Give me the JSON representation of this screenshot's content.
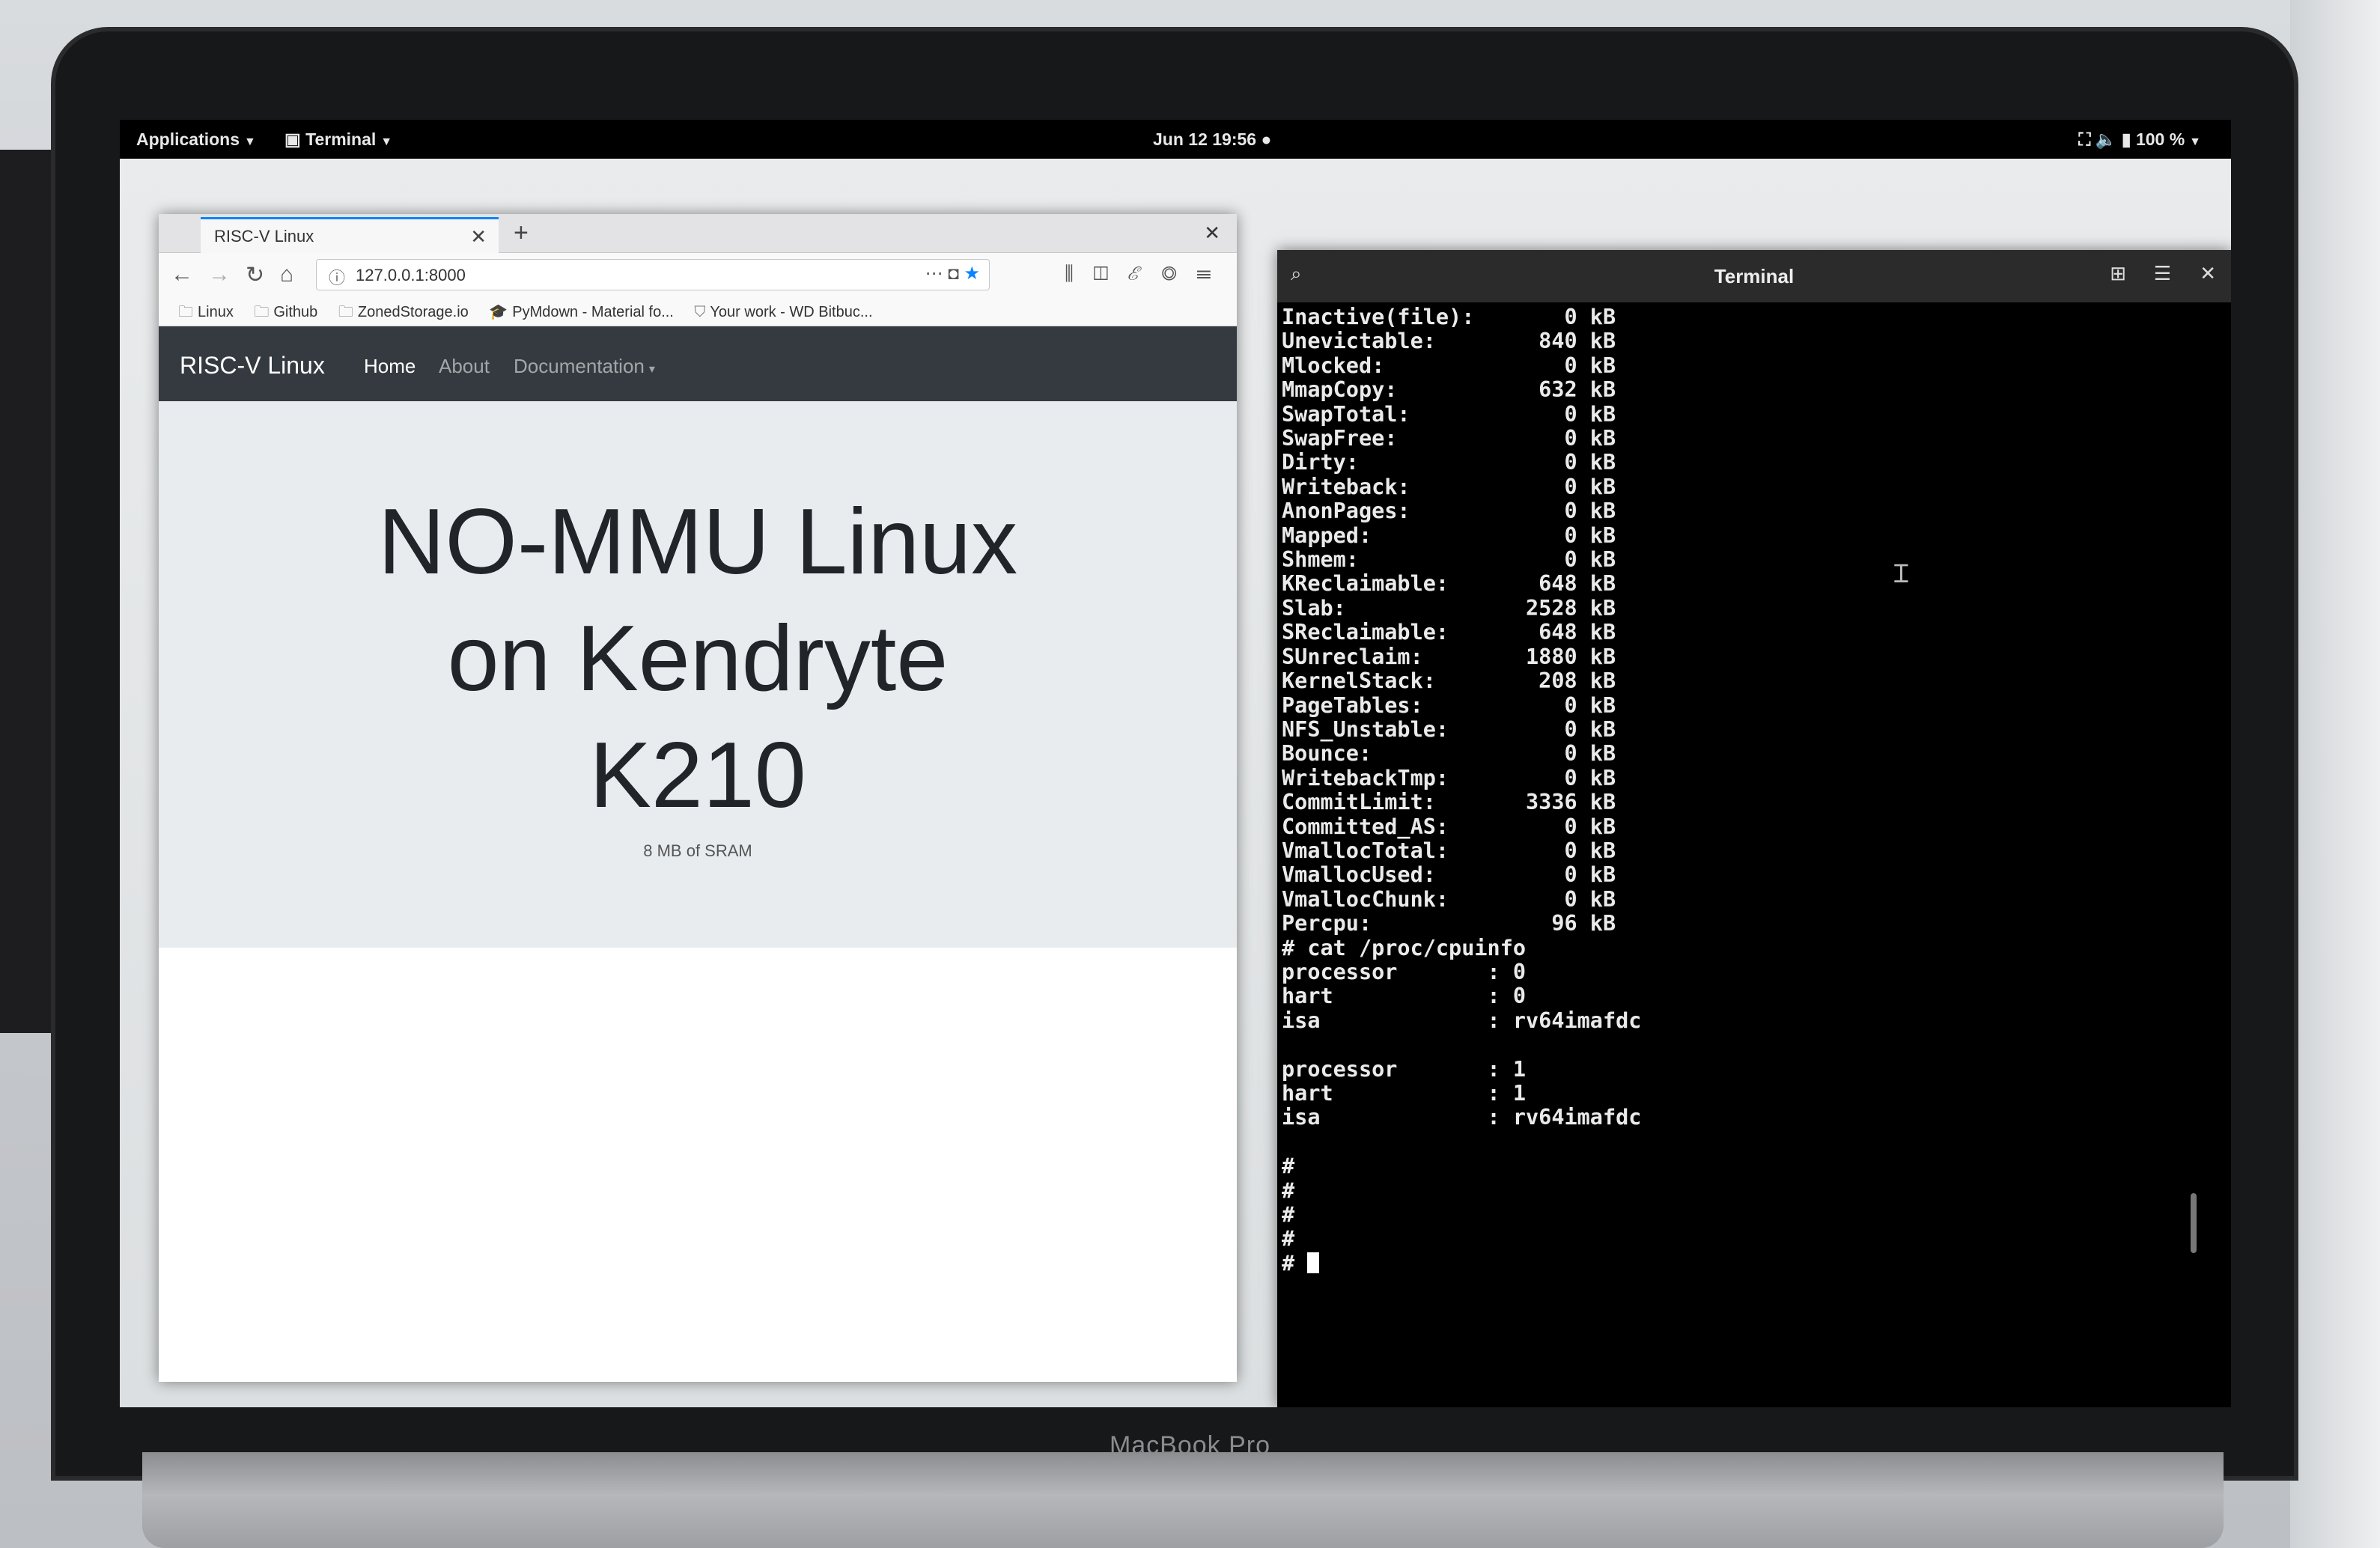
{
  "topbar": {
    "applications": "Applications",
    "terminal": "Terminal",
    "clock": "Jun 12  19:56 ●",
    "battery": "100 %"
  },
  "browser": {
    "tab_title": "RISC-V Linux",
    "url": "127.0.0.1:8000",
    "bookmarks": [
      "Linux",
      "Github",
      "ZonedStorage.io",
      "PyMdown - Material fo...",
      "Your work - WD Bitbuc..."
    ],
    "site": {
      "brand": "RISC-V Linux",
      "nav": [
        "Home",
        "About",
        "Documentation"
      ],
      "hero_line1": "NO-MMU Linux",
      "hero_line2": "on Kendryte",
      "hero_line3": "K210",
      "hero_sub": "8 MB of SRAM"
    }
  },
  "terminal": {
    "title": "Terminal",
    "output": "Inactive(file):       0 kB\nUnevictable:        840 kB\nMlocked:              0 kB\nMmapCopy:           632 kB\nSwapTotal:            0 kB\nSwapFree:             0 kB\nDirty:                0 kB\nWriteback:            0 kB\nAnonPages:            0 kB\nMapped:               0 kB\nShmem:                0 kB\nKReclaimable:       648 kB\nSlab:              2528 kB\nSReclaimable:       648 kB\nSUnreclaim:        1880 kB\nKernelStack:        208 kB\nPageTables:           0 kB\nNFS_Unstable:         0 kB\nBounce:               0 kB\nWritebackTmp:         0 kB\nCommitLimit:       3336 kB\nCommitted_AS:         0 kB\nVmallocTotal:         0 kB\nVmallocUsed:          0 kB\nVmallocChunk:         0 kB\nPercpu:              96 kB\n# cat /proc/cpuinfo\nprocessor       : 0\nhart            : 0\nisa             : rv64imafdc\n\nprocessor       : 1\nhart            : 1\nisa             : rv64imafdc\n\n#\n#\n#\n#\n# "
  },
  "device": {
    "brand": "MacBook Pro"
  }
}
